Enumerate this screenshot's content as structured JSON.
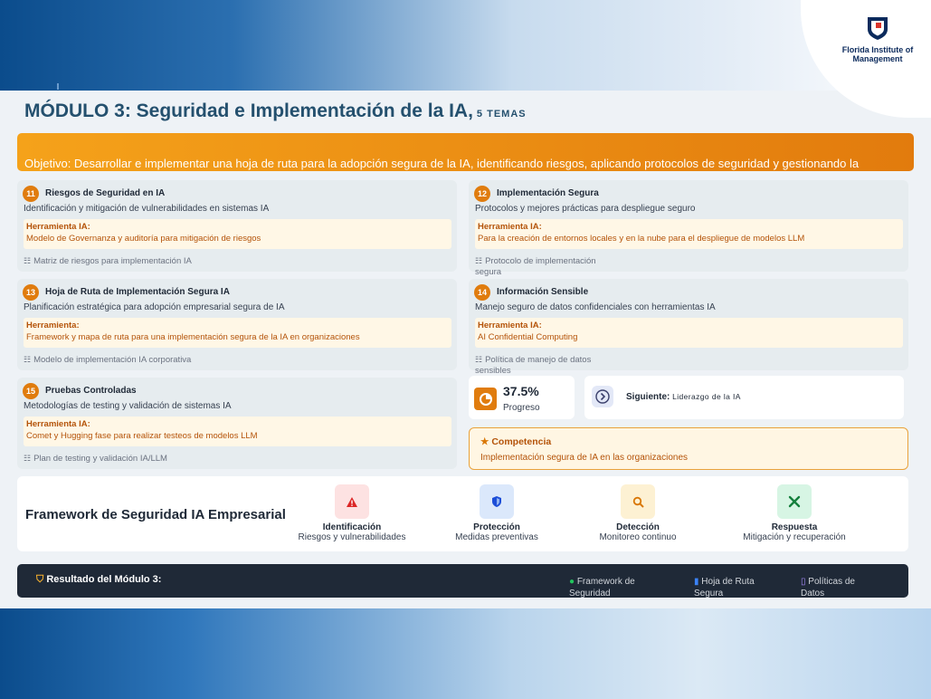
{
  "header": {
    "title": "MÓDULO 3: Seguridad e Implementación de la IA,",
    "subtitle": "5 TEMAS",
    "logo_text": "Florida Institute of Management"
  },
  "objective": "Objetivo: Desarrollar e implementar una hoja de ruta para la adopción segura de la IA, identificando riesgos, aplicando protocolos de seguridad y gestionando la información sensible de la organización.",
  "topics": [
    {
      "num": "11",
      "title": "Riesgos de Seguridad en IA",
      "desc": "Identificación y mitigación de vulnerabilidades en sistemas IA",
      "tool_label": "Herramienta IA:",
      "tool_value": "Modelo de Governanza y auditoría para mitigación de riesgos",
      "foot": "Matriz de riesgos para implementación IA"
    },
    {
      "num": "12",
      "title": "Implementación Segura",
      "desc": "Protocolos y mejores prácticas para despliegue seguro",
      "tool_label": "Herramienta IA:",
      "tool_value": "Para la creación de entornos locales y en la nube para el despliegue de modelos LLM",
      "foot": "Protocolo de implementación segura"
    },
    {
      "num": "13",
      "title": "Hoja de Ruta de Implementación Segura IA",
      "desc": "Planificación estratégica para adopción empresarial segura de IA",
      "tool_label": "Herramienta:",
      "tool_value": "Framework y mapa de ruta para una implementación segura de la IA en organizaciones",
      "foot": "Modelo de implementación IA corporativa"
    },
    {
      "num": "14",
      "title": "Información Sensible",
      "desc": "Manejo seguro de datos confidenciales con herramientas IA",
      "tool_label": "Herramienta IA:",
      "tool_value": "AI Confidential Computing",
      "foot": "Política de manejo de datos sensibles"
    },
    {
      "num": "15",
      "title": "Pruebas Controladas",
      "desc": "Metodologías de testing y validación de sistemas IA",
      "tool_label": "Herramienta IA:",
      "tool_value": "Comet y Hugging fase para realizar testeos de modelos LLM",
      "foot": "Plan de testing y validación IA/LLM"
    }
  ],
  "progress": {
    "value": "37.5%",
    "label": "Progreso"
  },
  "next": {
    "label": "Siguiente:",
    "value": "Liderazgo de la IA"
  },
  "competence": {
    "title": "Competencia",
    "value": "Implementación segura de IA en las organizaciones"
  },
  "framework": {
    "title": "Framework de Seguridad IA Empresarial",
    "items": [
      {
        "label": "Identificación",
        "sub": "Riesgos y vulnerabilidades",
        "color": "#fde2e2",
        "icon": "warning-icon"
      },
      {
        "label": "Protección",
        "sub": "Medidas preventivas",
        "color": "#dbe8fb",
        "icon": "shield-icon"
      },
      {
        "label": "Detección",
        "sub": "Monitoreo continuo",
        "color": "#fdf1d3",
        "icon": "search-icon"
      },
      {
        "label": "Respuesta",
        "sub": "Mitigación y recuperación",
        "color": "#d7f5e4",
        "icon": "tools-icon"
      }
    ]
  },
  "result": {
    "title": "Resultado del Módulo 3:",
    "items": [
      {
        "label": "Framework de Seguridad",
        "icon": "check-circle-icon"
      },
      {
        "label": "Hoja de Ruta Segura",
        "icon": "map-icon"
      },
      {
        "label": "Políticas de Datos",
        "icon": "document-icon"
      }
    ]
  }
}
